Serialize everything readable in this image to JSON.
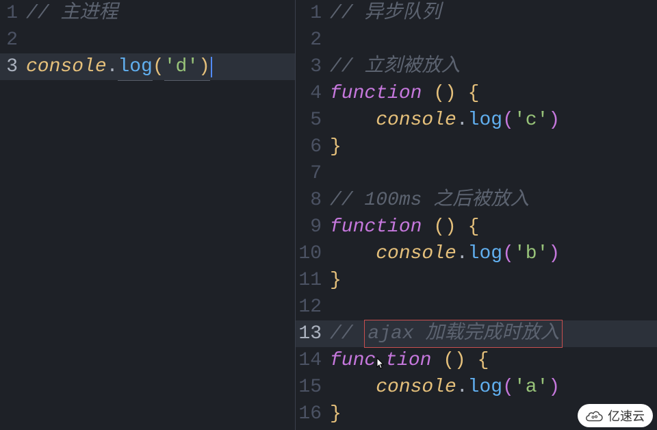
{
  "leftPane": {
    "activeLine": 3,
    "lines": [
      {
        "n": 1,
        "type": "comment",
        "text": "// 主进程"
      },
      {
        "n": 2,
        "type": "blank",
        "text": ""
      },
      {
        "n": 3,
        "type": "code",
        "tokens": [
          {
            "t": "console",
            "text": "console"
          },
          {
            "t": "dot",
            "text": "."
          },
          {
            "t": "method",
            "text": "log",
            "underline": true
          },
          {
            "t": "br-yellow",
            "text": "("
          },
          {
            "t": "str",
            "text": "'d'",
            "underline": true
          },
          {
            "t": "br-yellow",
            "text": ")",
            "underline": true
          }
        ],
        "cursor": true
      }
    ]
  },
  "rightPane": {
    "activeLine": 13,
    "lines": [
      {
        "n": 1,
        "type": "comment",
        "text": "// 异步队列"
      },
      {
        "n": 2,
        "type": "blank",
        "text": ""
      },
      {
        "n": 3,
        "type": "comment",
        "text": "// 立刻被放入"
      },
      {
        "n": 4,
        "type": "code",
        "tokens": [
          {
            "t": "keyword",
            "text": "function "
          },
          {
            "t": "br-yellow",
            "text": "("
          },
          {
            "t": "br-yellow",
            "text": ") "
          },
          {
            "t": "br-yellow",
            "text": "{"
          }
        ]
      },
      {
        "n": 5,
        "type": "code",
        "tokens": [
          {
            "t": "punct",
            "text": "    "
          },
          {
            "t": "console",
            "text": "console"
          },
          {
            "t": "dot",
            "text": "."
          },
          {
            "t": "method",
            "text": "log"
          },
          {
            "t": "br-purple",
            "text": "("
          },
          {
            "t": "str",
            "text": "'c'"
          },
          {
            "t": "br-purple",
            "text": ")"
          }
        ]
      },
      {
        "n": 6,
        "type": "code",
        "tokens": [
          {
            "t": "br-yellow",
            "text": "}"
          }
        ]
      },
      {
        "n": 7,
        "type": "blank",
        "text": ""
      },
      {
        "n": 8,
        "type": "comment",
        "text": "// 100ms 之后被放入"
      },
      {
        "n": 9,
        "type": "code",
        "tokens": [
          {
            "t": "keyword",
            "text": "function "
          },
          {
            "t": "br-yellow",
            "text": "("
          },
          {
            "t": "br-yellow",
            "text": ") "
          },
          {
            "t": "br-yellow",
            "text": "{"
          }
        ]
      },
      {
        "n": 10,
        "type": "code",
        "tokens": [
          {
            "t": "punct",
            "text": "    "
          },
          {
            "t": "console",
            "text": "console"
          },
          {
            "t": "dot",
            "text": "."
          },
          {
            "t": "method",
            "text": "log"
          },
          {
            "t": "br-purple",
            "text": "("
          },
          {
            "t": "str",
            "text": "'b'"
          },
          {
            "t": "br-purple",
            "text": ")"
          }
        ]
      },
      {
        "n": 11,
        "type": "code",
        "tokens": [
          {
            "t": "br-yellow",
            "text": "}"
          }
        ]
      },
      {
        "n": 12,
        "type": "blank",
        "text": ""
      },
      {
        "n": 13,
        "type": "comment-boxed",
        "text": "// ",
        "boxed": "ajax 加载完成时放入"
      },
      {
        "n": 14,
        "type": "code",
        "tokens": [
          {
            "t": "keyword",
            "text": "func"
          },
          {
            "t": "cursor-ptr"
          },
          {
            "t": "keyword",
            "text": "tion "
          },
          {
            "t": "br-yellow",
            "text": "("
          },
          {
            "t": "br-yellow",
            "text": ") "
          },
          {
            "t": "br-yellow",
            "text": "{"
          }
        ]
      },
      {
        "n": 15,
        "type": "code",
        "tokens": [
          {
            "t": "punct",
            "text": "    "
          },
          {
            "t": "console",
            "text": "console"
          },
          {
            "t": "dot",
            "text": "."
          },
          {
            "t": "method",
            "text": "log"
          },
          {
            "t": "br-purple",
            "text": "("
          },
          {
            "t": "str",
            "text": "'a'"
          },
          {
            "t": "br-purple",
            "text": ")"
          }
        ]
      },
      {
        "n": 16,
        "type": "code",
        "tokens": [
          {
            "t": "br-yellow",
            "text": "}"
          }
        ]
      }
    ]
  },
  "watermark": "亿速云"
}
